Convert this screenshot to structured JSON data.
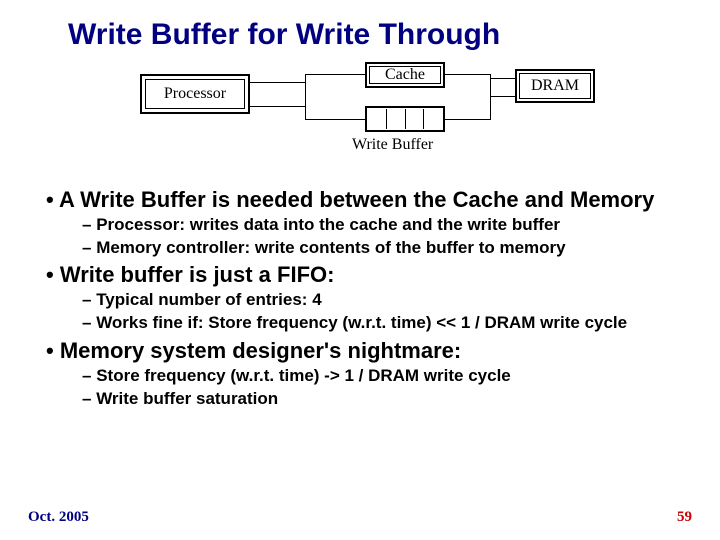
{
  "title": "Write Buffer for Write Through",
  "diagram": {
    "processor": "Processor",
    "cache": "Cache",
    "dram": "DRAM",
    "write_buffer_label": "Write Buffer",
    "fifo_entries": 4
  },
  "bullets": [
    {
      "text": "A Write Buffer is needed between the Cache and Memory",
      "sub": [
        "Processor: writes data into the cache and the write buffer",
        "Memory controller: write contents of the buffer to memory"
      ]
    },
    {
      "text": "Write buffer is just a FIFO:",
      "sub": [
        "Typical number of entries: 4",
        "Works fine if:  Store frequency (w.r.t. time) << 1 / DRAM write cycle"
      ]
    },
    {
      "text": "Memory system designer's nightmare:",
      "sub": [
        "Store frequency (w.r.t. time)   ->  1 / DRAM write cycle",
        "Write buffer saturation"
      ]
    }
  ],
  "footer": {
    "date": "Oct. 2005",
    "page": "59"
  }
}
